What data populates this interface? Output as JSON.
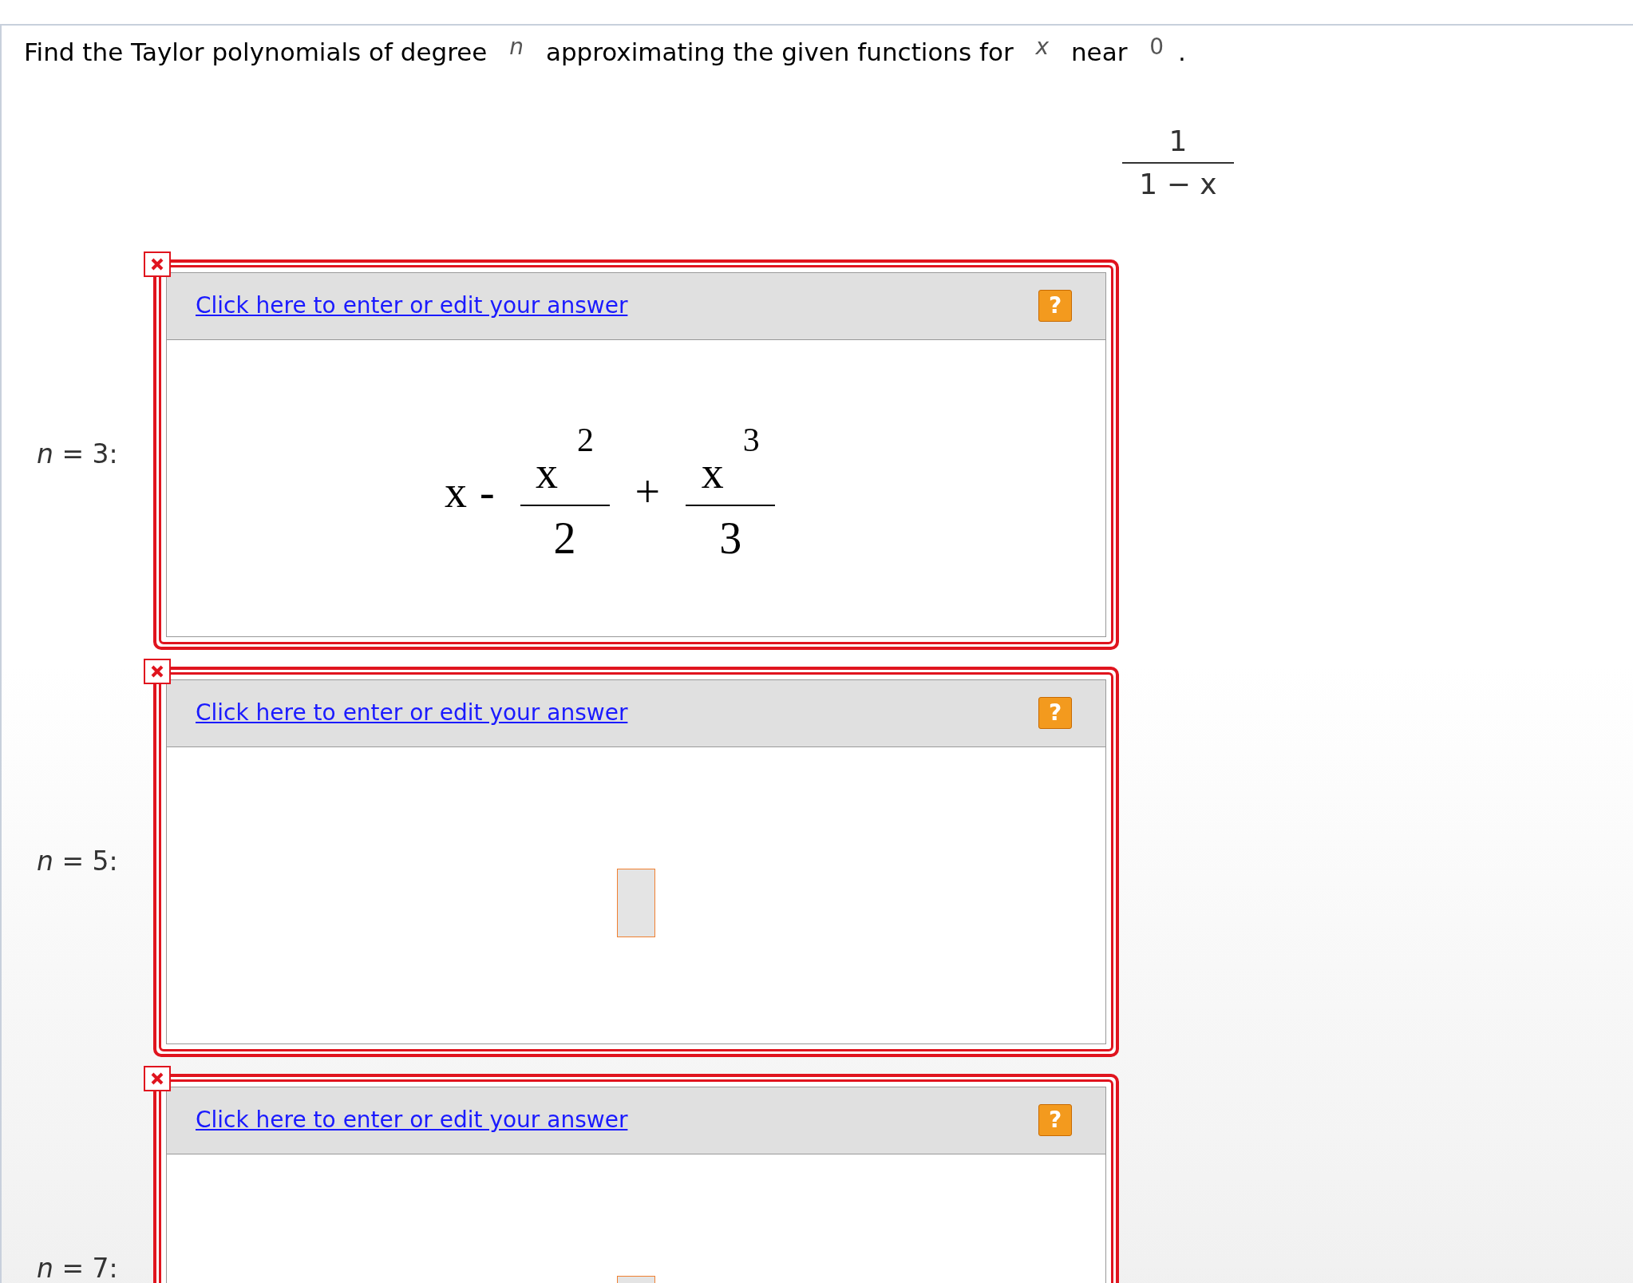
{
  "question": {
    "before": "Find the Taylor polynomials of degree",
    "var_degree": "n",
    "middle": "approximating the given functions for",
    "var_x": "x",
    "near": "near",
    "point": "0",
    "end": "."
  },
  "function": {
    "numerator": "1",
    "denominator": "1 − x"
  },
  "answers": [
    {
      "label_var": "n",
      "label_rest": "= 3:",
      "link": "Click here to enter or edit your answer",
      "help": "?",
      "kind": "expression",
      "parts": [
        {
          "kind": "text",
          "text": "x"
        },
        {
          "kind": "op",
          "text": "-"
        },
        {
          "kind": "frac",
          "base": "x",
          "exponent": "2",
          "denominator": "2"
        },
        {
          "kind": "op",
          "text": "+"
        },
        {
          "kind": "frac",
          "base": "x",
          "exponent": "3",
          "denominator": "3"
        }
      ]
    },
    {
      "label_var": "n",
      "label_rest": "= 5:",
      "link": "Click here to enter or edit your answer",
      "help": "?",
      "kind": "empty"
    },
    {
      "label_var": "n",
      "label_rest": "= 7:",
      "link": "Click here to enter or edit your answer",
      "help": "?",
      "kind": "empty"
    }
  ]
}
